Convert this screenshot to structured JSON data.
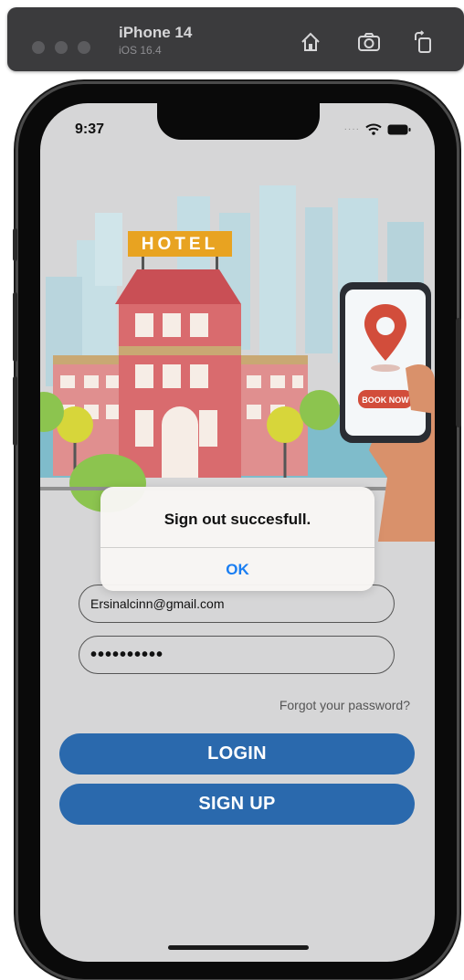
{
  "simulator": {
    "device_name": "iPhone 14",
    "os_version": "iOS 16.4"
  },
  "status_bar": {
    "time": "9:37"
  },
  "illustration": {
    "hotel_sign": "HOTEL",
    "book_now": "BOOK NOW"
  },
  "form": {
    "email_value": "Ersinalcinn@gmail.com",
    "password_mask": "••••••••••",
    "forgot_password": "Forgot your password?",
    "login_label": "LOGIN",
    "signup_label": "SIGN UP"
  },
  "alert": {
    "message": "Sign out succesfull.",
    "ok_label": "OK"
  },
  "colors": {
    "primary_button": "#2a69ad",
    "alert_action": "#1a7ef2",
    "screen_bg": "#d6d6d7"
  }
}
